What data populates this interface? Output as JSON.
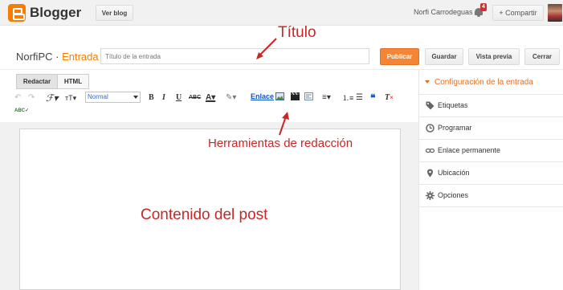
{
  "topbar": {
    "logo_text": "Blogger",
    "view_blog": "Ver blog",
    "user_name": "Norfi Carrodeguas",
    "notifications": "4",
    "share": "+ Compartir"
  },
  "header": {
    "blog_name": "NorfiPC",
    "separator": " · ",
    "section": "Entrada",
    "title_placeholder": "Título de la entrada",
    "publish": "Publicar",
    "save": "Guardar",
    "preview": "Vista previa",
    "close": "Cerrar"
  },
  "editor": {
    "tabs": [
      "Redactar",
      "HTML"
    ],
    "font_size_value": "Normal",
    "link": "Enlace"
  },
  "sidebar": {
    "title": "Configuración de la entrada",
    "items": [
      {
        "label": "Etiquetas",
        "icon": "tag-icon"
      },
      {
        "label": "Programar",
        "icon": "clock-icon"
      },
      {
        "label": "Enlace permanente",
        "icon": "link-icon"
      },
      {
        "label": "Ubicación",
        "icon": "location-pin-icon"
      },
      {
        "label": "Opciones",
        "icon": "gear-icon"
      }
    ]
  },
  "annotations": {
    "title": "Título",
    "tools": "Herramientas de redacción",
    "content": "Contenido del post"
  },
  "colors": {
    "accent": "#f57d00",
    "publish": "#f48535",
    "annotation": "#c62828",
    "link": "#1155cc"
  }
}
